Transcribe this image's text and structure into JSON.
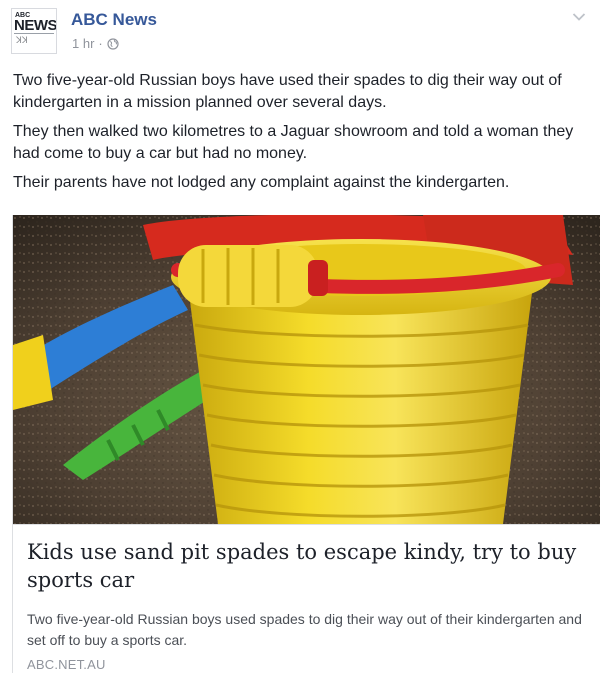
{
  "post": {
    "author": {
      "name": "ABC News",
      "avatar_text": "NEWS",
      "avatar_small": "ABC",
      "avatar_sub": "ꓘꓘ"
    },
    "meta": {
      "time": "1 hr",
      "separator": "·",
      "audience_icon": "globe-icon"
    },
    "menu_icon": "chevron-down-icon",
    "paragraphs": [
      "Two five-year-old Russian boys have used their spades to dig their way out of kindergarten in a mission planned over several days.",
      "They then walked two kilometres to a Jaguar showroom and told a woman they had come to buy a car but had no money.",
      "Their parents have not lodged any complaint against the kindergarten."
    ],
    "link": {
      "title": "Kids use sand pit spades to escape kindy, try to buy sports car",
      "description": "Two five-year-old Russian boys used spades to dig their way out of their kindergarten and set off to buy a sports car.",
      "domain": "ABC.NET.AU"
    }
  },
  "colors": {
    "name_link": "#365899",
    "text": "#1d2129",
    "muted": "#90949c",
    "bucket_yellow": "#f2d21a",
    "handle_red": "#d9262b",
    "spade_blue": "#2c7fd8",
    "spade_green": "#46b83a",
    "sand": "#5a4a3a"
  }
}
